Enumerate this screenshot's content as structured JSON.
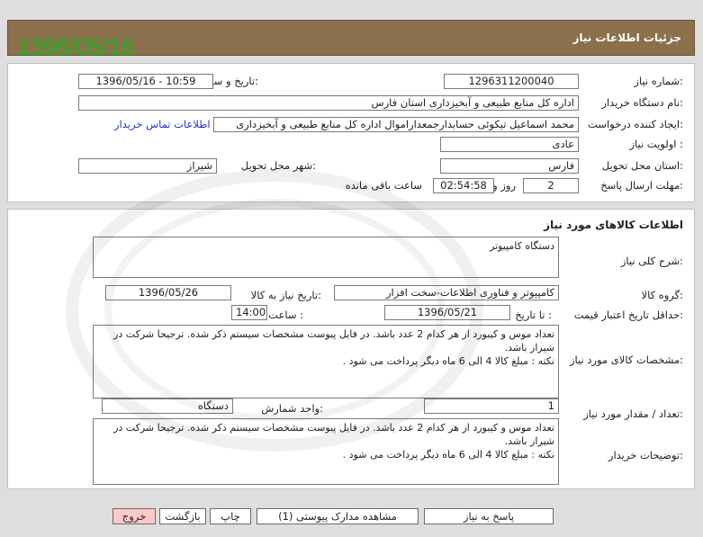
{
  "header": {
    "date_watermark": "1396/05/16",
    "title": "جزئیات اطلاعات نیاز"
  },
  "labels": {
    "need_number": "شماره نیاز:",
    "announce_datetime": "تاریخ و ساعت اعلان عمومی:",
    "buyer_org": "نام دستگاه خریدار:",
    "requester": "ایجاد کننده درخواست:",
    "priority": "اولویت نیاز :",
    "province": "استان محل تحویل:",
    "city": "شهر محل تحویل:",
    "deadline": "مهلت ارسال پاسخ:",
    "days_word": "روز و",
    "remaining_word": "ساعت باقی مانده",
    "goods_info": "اطلاعات کالاهای مورد نیاز",
    "general_desc": "شرح کلی نیاز:",
    "goods_group": "گروه کالا:",
    "need_date": "تاریخ نیاز به کالا:",
    "min_validity": "حداقل تاریخ اعتبار قیمت:",
    "to_date": "تا تاریخ :",
    "time": "ساعت :",
    "goods_specs": "مشخصات کالای مورد نیاز:",
    "qty": "تعداد / مقدار مورد نیاز:",
    "unit": "واحد شمارش:",
    "buyer_desc": "توضیحات خریدار:"
  },
  "values": {
    "need_number": "1296311200040",
    "announce_datetime": "1396/05/16 - 10:59",
    "buyer_org": "اداره کل منابع طبیعی و آبخیزداری استان فارس",
    "requester": "محمد اسماعیل  تیکوئی  حسابدارجمعداراموال اداره کل منابع طبیعی و آبخیزداری",
    "contact_link": "اطلاعات تماس خریدار",
    "priority": "عادی",
    "province": "فارس",
    "city": "شیراز",
    "days": "2",
    "remaining_time": "02:54:58",
    "general_desc": "دستگاه کامپیوتر",
    "goods_group": "کامپیوتر و فناوری اطلاعات-سخت افزار",
    "need_date": "1396/05/26",
    "validity_date": "1396/05/21",
    "validity_time": "14:00",
    "specs_text": "تعداد موس و کیبورد از هر کدام 2 عدد باشد. در فایل پیوست مشخصات سیستم ذکر شده. ترجیحا شرکت در شیراز باشد.\nنکته : مبلغ کالا 4 الی 6 ماه دیگر پرداخت می شود .",
    "qty": "1",
    "unit": "دستگاه",
    "buyer_desc_text": "تعداد موس و کیبورد از هر کدام 2 عدد باشد. در فایل پیوست مشخصات سیستم ذکر شده. ترجیحا شرکت در شیراز باشد.\nنکته : مبلغ کالا 4 الی 6 ماه دیگر پرداخت می شود ."
  },
  "buttons": {
    "reply": "پاسخ به نیاز",
    "attachments": "مشاهده مدارک پیوستی (1)",
    "print": "چاپ",
    "back": "بازگشت",
    "exit": "خروج"
  },
  "colors": {
    "header_bg": "#8c6f4d",
    "watermark": "#1db41d",
    "link": "#2233cc",
    "exit_bg": "#ffc9c9"
  }
}
